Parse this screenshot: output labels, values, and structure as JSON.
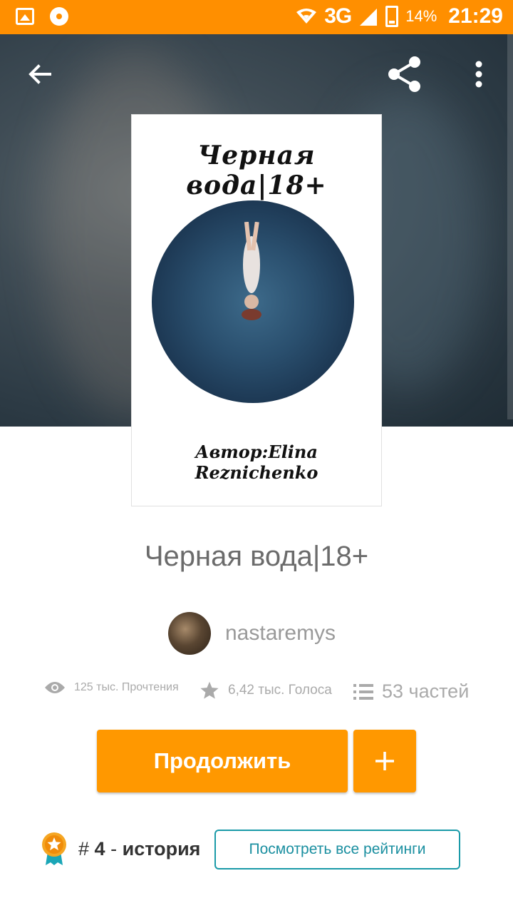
{
  "status_bar": {
    "network": "3G",
    "battery": "14%",
    "time": "21:29",
    "icons": [
      "image-icon",
      "media-icon",
      "wifi-icon",
      "signal-icon",
      "battery-charging-icon"
    ]
  },
  "appbar": {
    "icons": [
      "back-arrow-icon",
      "share-icon",
      "more-vert-icon"
    ]
  },
  "cover": {
    "title": "Черная вода|18+",
    "author": "Автор:Elina Reznichenko"
  },
  "story": {
    "title": "Черная вода|18+",
    "author": "nastaremys"
  },
  "stats": {
    "reads": "125 тыс. Прочтения",
    "votes": "6,42 тыс. Голоса",
    "parts": "53 частей"
  },
  "actions": {
    "continue_label": "Продолжить",
    "add_label": "+"
  },
  "ranking": {
    "hash": "#",
    "rank": "4",
    "separator": "-",
    "category": "история",
    "view_all_label": "Посмотреть все рейтинги"
  },
  "colors": {
    "status_bar": "#ff8f00",
    "primary_button": "#ff9800",
    "ratings_outline": "#1a9aa8",
    "medal": "#f5a623",
    "ribbon": "#1aa6b7"
  }
}
